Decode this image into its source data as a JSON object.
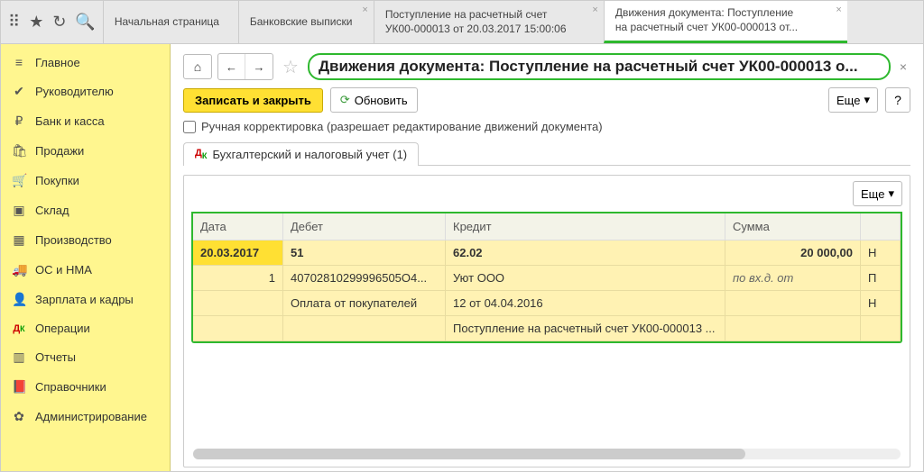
{
  "topbar": {
    "tabs": [
      {
        "line1": "Начальная страница",
        "line2": ""
      },
      {
        "line1": "Банковские выписки",
        "line2": ""
      },
      {
        "line1": "Поступление на расчетный счет",
        "line2": "УК00-000013 от 20.03.2017 15:00:06"
      },
      {
        "line1": "Движения документа: Поступление",
        "line2": "на расчетный счет УК00-000013 от..."
      }
    ]
  },
  "sidebar": {
    "items": [
      {
        "icon": "≡",
        "label": "Главное"
      },
      {
        "icon": "✔",
        "label": "Руководителю"
      },
      {
        "icon": "₽",
        "label": "Банк и касса"
      },
      {
        "icon": "🛍",
        "label": "Продажи"
      },
      {
        "icon": "🛒",
        "label": "Покупки"
      },
      {
        "icon": "▣",
        "label": "Склад"
      },
      {
        "icon": "▦",
        "label": "Производство"
      },
      {
        "icon": "🚚",
        "label": "ОС и НМА"
      },
      {
        "icon": "👤",
        "label": "Зарплата и кадры"
      },
      {
        "icon": "Дт",
        "label": "Операции"
      },
      {
        "icon": "▥",
        "label": "Отчеты"
      },
      {
        "icon": "📕",
        "label": "Справочники"
      },
      {
        "icon": "✿",
        "label": "Администрирование"
      }
    ]
  },
  "header": {
    "title": "Движения документа: Поступление на расчетный счет УК00-000013 о..."
  },
  "toolbar": {
    "save_close": "Записать и закрыть",
    "refresh": "Обновить",
    "more": "Еще",
    "help": "?"
  },
  "checkbox": {
    "label": "Ручная корректировка (разрешает редактирование движений документа)"
  },
  "subtab": {
    "label": "Бухгалтерский и налоговый учет (1)"
  },
  "grid": {
    "headers": {
      "date": "Дата",
      "debit": "Дебет",
      "credit": "Кредит",
      "sum": "Сумма"
    },
    "rows": [
      {
        "date": "20.03.2017",
        "debit": "51",
        "credit": "62.02",
        "sum": "20 000,00",
        "extra": "Н"
      },
      {
        "date": "1",
        "debit": "40702810299996505О4...",
        "credit": "Уют ООО",
        "sum": "по вх.д.  от",
        "extra": "П"
      },
      {
        "date": "",
        "debit": "Оплата от покупателей",
        "credit": "12 от 04.04.2016",
        "sum": "",
        "extra": "Н"
      },
      {
        "date": "",
        "debit": "",
        "credit": "Поступление на расчетный счет УК00-000013 ...",
        "sum": "",
        "extra": ""
      }
    ]
  }
}
